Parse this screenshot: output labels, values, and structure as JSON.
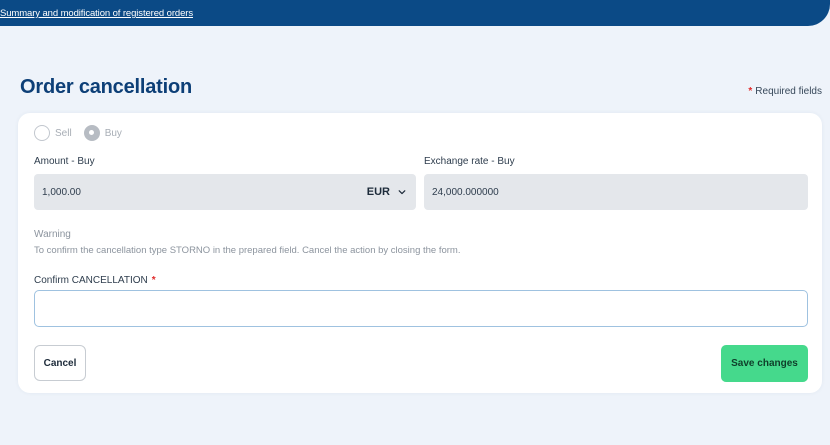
{
  "topbar": {
    "link": "Summary and modification of registered orders",
    "color": "#0b4a86"
  },
  "page": {
    "title": "Order cancellation",
    "required_note": "Required fields",
    "required_marker": "*"
  },
  "direction": {
    "options": [
      {
        "label": "Sell",
        "selected": false
      },
      {
        "label": "Buy",
        "selected": true
      }
    ]
  },
  "amount": {
    "label": "Amount - Buy",
    "value": "1,000.00",
    "currency": "EUR"
  },
  "exchange_rate": {
    "label": "Exchange rate - Buy",
    "value": "24,000.000000"
  },
  "warning": {
    "title": "Warning",
    "text": "To confirm the cancellation type STORNO in the prepared field. Cancel the action by closing the form."
  },
  "confirm": {
    "label": "Confirm CANCELLATION",
    "required_marker": "*",
    "value": ""
  },
  "actions": {
    "cancel_label": "Cancel",
    "save_label": "Save changes",
    "save_color": "#45d98c"
  },
  "icons": {
    "currency_dropdown": "chevron-down-icon"
  }
}
